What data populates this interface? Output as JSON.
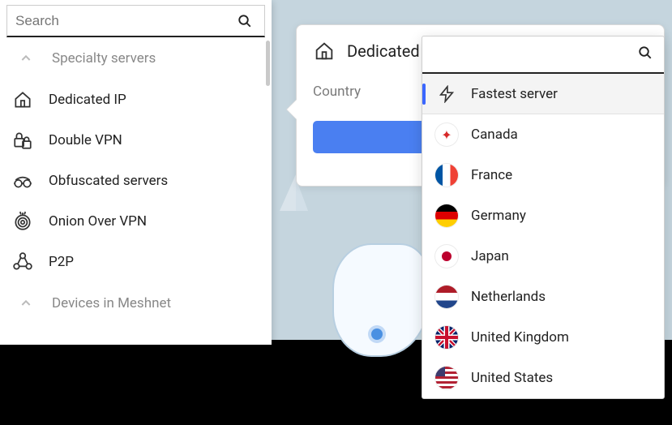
{
  "search": {
    "placeholder": "Search"
  },
  "sidebar": {
    "section1_label": "Specialty servers",
    "items": [
      {
        "label": "Dedicated IP",
        "icon": "house-icon"
      },
      {
        "label": "Double VPN",
        "icon": "double-lock-icon"
      },
      {
        "label": "Obfuscated servers",
        "icon": "goggles-icon"
      },
      {
        "label": "Onion Over VPN",
        "icon": "onion-icon"
      },
      {
        "label": "P2P",
        "icon": "p2p-icon"
      }
    ],
    "section2_label": "Devices in Meshnet"
  },
  "panel": {
    "title": "Dedicated IP",
    "country_label": "Country"
  },
  "dropdown": {
    "fastest_label": "Fastest server",
    "countries": [
      {
        "label": "Canada",
        "flag": "ca"
      },
      {
        "label": "France",
        "flag": "fr"
      },
      {
        "label": "Germany",
        "flag": "de"
      },
      {
        "label": "Japan",
        "flag": "jp"
      },
      {
        "label": "Netherlands",
        "flag": "nl"
      },
      {
        "label": "United Kingdom",
        "flag": "uk"
      },
      {
        "label": "United States",
        "flag": "us"
      }
    ]
  }
}
